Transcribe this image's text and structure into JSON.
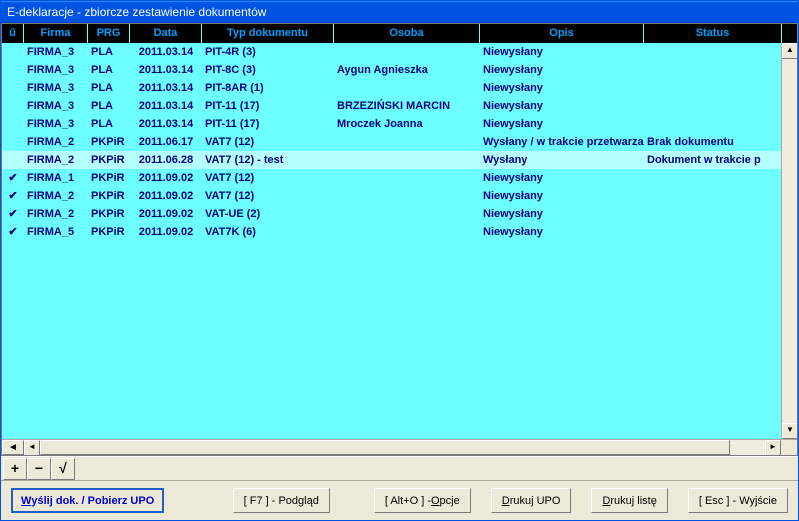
{
  "window": {
    "title": "E-deklaracje - zbiorcze zestawienie dokumentów"
  },
  "columns": {
    "check": "ű",
    "firma": "Firma",
    "prg": "PRG",
    "data": "Data",
    "typ": "Typ dokumentu",
    "osoba": "Osoba",
    "opis": "Opis",
    "status": "Status"
  },
  "rows": [
    {
      "checked": false,
      "firma": "FIRMA_3",
      "prg": "PLA",
      "data": "2011.03.14",
      "typ": "PIT-4R (3)",
      "osoba": "",
      "opis": "Niewysłany",
      "status": ""
    },
    {
      "checked": false,
      "firma": "FIRMA_3",
      "prg": "PLA",
      "data": "2011.03.14",
      "typ": "PIT-8C (3)",
      "osoba": "Aygun Agnieszka",
      "opis": "Niewysłany",
      "status": ""
    },
    {
      "checked": false,
      "firma": "FIRMA_3",
      "prg": "PLA",
      "data": "2011.03.14",
      "typ": "PIT-8AR (1)",
      "osoba": "",
      "opis": "Niewysłany",
      "status": ""
    },
    {
      "checked": false,
      "firma": "FIRMA_3",
      "prg": "PLA",
      "data": "2011.03.14",
      "typ": "PIT-11 (17)",
      "osoba": "BRZEZIŃSKI MARCIN",
      "opis": "Niewysłany",
      "status": ""
    },
    {
      "checked": false,
      "firma": "FIRMA_3",
      "prg": "PLA",
      "data": "2011.03.14",
      "typ": "PIT-11 (17)",
      "osoba": "Mroczek Joanna",
      "opis": "Niewysłany",
      "status": ""
    },
    {
      "checked": false,
      "firma": "FIRMA_2",
      "prg": "PKPiR",
      "data": "2011.06.17",
      "typ": "VAT7 (12)",
      "osoba": "",
      "opis": "Wysłany / w trakcie przetwarzania",
      "status": "Brak dokumentu"
    },
    {
      "checked": false,
      "firma": "FIRMA_2",
      "prg": "PKPiR",
      "data": "2011.06.28",
      "typ": "VAT7 (12) - test",
      "osoba": "",
      "opis": "Wysłany",
      "status": "Dokument w trakcie p",
      "selected": true
    },
    {
      "checked": true,
      "firma": "FIRMA_1",
      "prg": "PKPiR",
      "data": "2011.09.02",
      "typ": "VAT7 (12)",
      "osoba": "",
      "opis": "Niewysłany",
      "status": ""
    },
    {
      "checked": true,
      "firma": "FIRMA_2",
      "prg": "PKPiR",
      "data": "2011.09.02",
      "typ": "VAT7 (12)",
      "osoba": "",
      "opis": "Niewysłany",
      "status": ""
    },
    {
      "checked": true,
      "firma": "FIRMA_2",
      "prg": "PKPiR",
      "data": "2011.09.02",
      "typ": "VAT-UE (2)",
      "osoba": "",
      "opis": "Niewysłany",
      "status": ""
    },
    {
      "checked": true,
      "firma": "FIRMA_5",
      "prg": "PKPiR",
      "data": "2011.09.02",
      "typ": "VAT7K (6)",
      "osoba": "",
      "opis": "Niewysłany",
      "status": ""
    }
  ],
  "nav": {
    "add": "+",
    "remove": "−",
    "confirm": "√"
  },
  "buttons": {
    "send_prefix": "W",
    "send_rest": "yślij dok. / Pobierz UPO",
    "preview": "[ F7 ] - Podgląd",
    "options_prefix": "[ Alt+O ] - ",
    "options_ul": "O",
    "options_rest": "pcje",
    "print_upo_ul": "D",
    "print_upo_rest": "rukuj UPO",
    "print_list_ul": "D",
    "print_list_rest": "rukuj listę",
    "exit": "[ Esc ] - Wyjście"
  }
}
